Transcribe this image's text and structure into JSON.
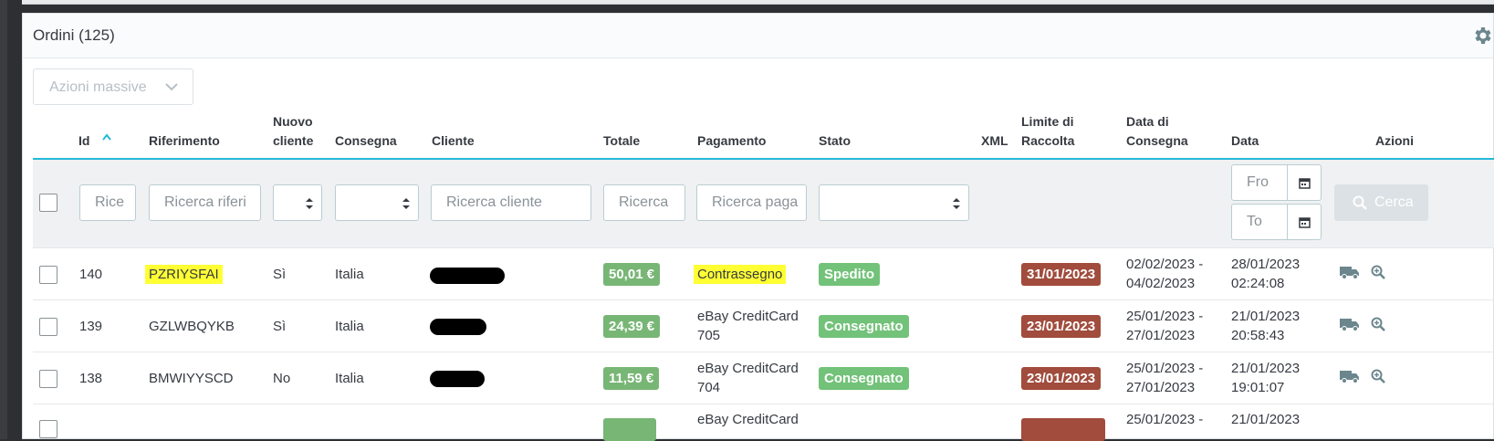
{
  "panel": {
    "title": "Ordini (125)"
  },
  "bulk_actions": {
    "label": "Azioni massive"
  },
  "columns": {
    "id": "Id",
    "riferimento": "Riferimento",
    "nuovo_cliente_1": "Nuovo",
    "nuovo_cliente_2": "cliente",
    "consegna": "Consegna",
    "cliente": "Cliente",
    "totale": "Totale",
    "pagamento": "Pagamento",
    "stato": "Stato",
    "xml": "XML",
    "limite_1": "Limite di",
    "limite_2": "Raccolta",
    "data_consegna_1": "Data di",
    "data_consegna_2": "Consegna",
    "data": "Data",
    "azioni": "Azioni"
  },
  "filters": {
    "id": "Rice",
    "riferimento": "Ricerca riferi",
    "cliente": "Ricerca cliente",
    "totale": "Ricerca",
    "pagamento": "Ricerca paga",
    "date_from": "Fro",
    "date_to": "To",
    "search_button": "Cerca"
  },
  "rows": [
    {
      "id": "140",
      "riferimento": "PZRIYSFAI",
      "nuovo_cliente": "Sì",
      "consegna": "Italia",
      "totale": "50,01 €",
      "pagamento_1": "Contrassegno",
      "pagamento_2": "",
      "stato": "Spedito",
      "limite": "31/01/2023",
      "data_consegna_1": "02/02/2023 -",
      "data_consegna_2": "04/02/2023",
      "data_1": "28/01/2023",
      "data_2": "02:24:08"
    },
    {
      "id": "139",
      "riferimento": "GZLWBQYKB",
      "nuovo_cliente": "Sì",
      "consegna": "Italia",
      "totale": "24,39 €",
      "pagamento_1": "eBay CreditCard",
      "pagamento_2": "705",
      "stato": "Consegnato",
      "limite": "23/01/2023",
      "data_consegna_1": "25/01/2023 -",
      "data_consegna_2": "27/01/2023",
      "data_1": "21/01/2023",
      "data_2": "20:58:43"
    },
    {
      "id": "138",
      "riferimento": "BMWIYYSCD",
      "nuovo_cliente": "No",
      "consegna": "Italia",
      "totale": "11,59 €",
      "pagamento_1": "eBay CreditCard",
      "pagamento_2": "704",
      "stato": "Consegnato",
      "limite": "23/01/2023",
      "data_consegna_1": "25/01/2023 -",
      "data_consegna_2": "27/01/2023",
      "data_1": "21/01/2023",
      "data_2": "19:01:07"
    },
    {
      "pagamento_1": "eBay CreditCard",
      "data_consegna_1": "25/01/2023 -",
      "data_1": "21/01/2023"
    }
  ],
  "colors": {
    "accent": "#25b9d7",
    "total_badge": "#78b676",
    "status_badge": "#72c279",
    "limit_badge": "#a14c3d",
    "highlight": "#ffff33"
  },
  "icons": [
    "gear-icon",
    "chevron-down-icon",
    "sort-up-icon",
    "select-arrows-icon",
    "calendar-icon",
    "search-icon",
    "truck-icon",
    "zoom-icon"
  ]
}
